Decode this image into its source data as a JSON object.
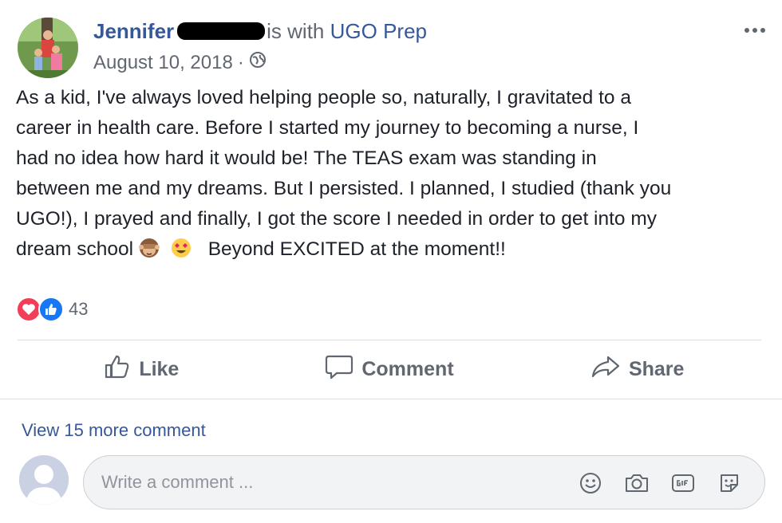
{
  "post": {
    "author": "Jennifer",
    "with_text": "is with",
    "tagged_page": "UGO Prep",
    "date": "August 10, 2018",
    "separator": "·",
    "body_lines": [
      "As a kid, I've always loved helping people so, naturally, I gravitated to a",
      "career in health care. Before I started my journey to becoming a nurse, I",
      "had no idea how hard it would be! The TEAS exam was standing in",
      "between me and my dreams. But I persisted. I planned, I studied (thank you",
      "UGO!), I prayed and finally, I got the score I needed in order to get into my",
      "dream school"
    ],
    "body_tail": "Beyond EXCITED at the moment!!"
  },
  "reactions": {
    "count": "43",
    "colors": {
      "love": "#f33e58",
      "like": "#1877f2"
    }
  },
  "actions": {
    "like": "Like",
    "comment": "Comment",
    "share": "Share"
  },
  "comments": {
    "view_more": "View 15 more comment",
    "placeholder": "Write a comment ..."
  },
  "icons": [
    "globe-icon",
    "more-icon",
    "heart-icon",
    "thumbs-up-icon",
    "like-icon",
    "comment-icon",
    "share-icon",
    "emoji-icon",
    "camera-icon",
    "gif-icon",
    "sticker-icon"
  ],
  "colors": {
    "link": "#365899",
    "muted": "#616770",
    "text": "#1d2129"
  }
}
